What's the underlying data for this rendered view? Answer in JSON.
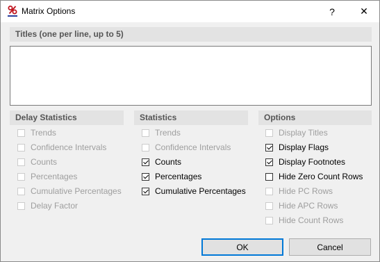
{
  "window": {
    "title": "Matrix Options",
    "help_glyph": "?",
    "close_glyph": "✕"
  },
  "titles": {
    "header": "Titles (one per line, up to 5)",
    "value": ""
  },
  "delay_statistics": {
    "header": "Delay Statistics",
    "items": [
      {
        "label": "Trends",
        "checked": false,
        "enabled": false
      },
      {
        "label": "Confidence Intervals",
        "checked": false,
        "enabled": false
      },
      {
        "label": "Counts",
        "checked": false,
        "enabled": false
      },
      {
        "label": "Percentages",
        "checked": false,
        "enabled": false
      },
      {
        "label": "Cumulative Percentages",
        "checked": false,
        "enabled": false
      },
      {
        "label": "Delay Factor",
        "checked": false,
        "enabled": false
      }
    ]
  },
  "statistics": {
    "header": "Statistics",
    "items": [
      {
        "label": "Trends",
        "checked": false,
        "enabled": false
      },
      {
        "label": "Confidence Intervals",
        "checked": false,
        "enabled": false
      },
      {
        "label": "Counts",
        "checked": true,
        "enabled": true
      },
      {
        "label": "Percentages",
        "checked": true,
        "enabled": true
      },
      {
        "label": "Cumulative Percentages",
        "checked": true,
        "enabled": true
      }
    ]
  },
  "options": {
    "header": "Options",
    "items": [
      {
        "label": "Display Titles",
        "checked": false,
        "enabled": false
      },
      {
        "label": "Display Flags",
        "checked": true,
        "enabled": true
      },
      {
        "label": "Display Footnotes",
        "checked": true,
        "enabled": true
      },
      {
        "label": "Hide Zero Count Rows",
        "checked": false,
        "enabled": true
      },
      {
        "label": "Hide PC Rows",
        "checked": false,
        "enabled": false
      },
      {
        "label": "Hide APC Rows",
        "checked": false,
        "enabled": false
      },
      {
        "label": "Hide Count Rows",
        "checked": false,
        "enabled": false
      }
    ]
  },
  "buttons": {
    "ok": "OK",
    "cancel": "Cancel"
  }
}
